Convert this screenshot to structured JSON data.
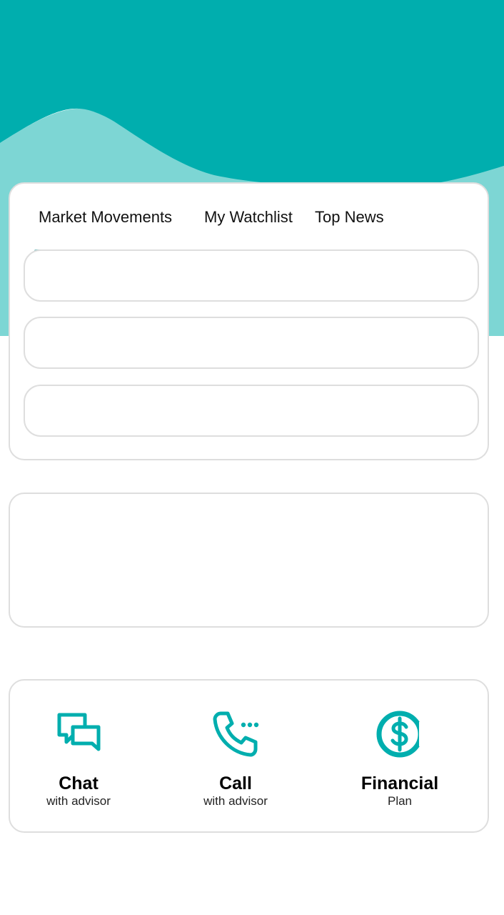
{
  "theme": {
    "primary_teal": "#00aeae",
    "light_teal": "#7dd6d4",
    "tab_underline": "#7dbfbf",
    "card_border": "#dedede"
  },
  "market_tabs": {
    "tabs": [
      {
        "label": "Market Movements",
        "selected": true
      },
      {
        "label": "My Watchlist",
        "selected": false
      },
      {
        "label": "Top News",
        "selected": false
      }
    ]
  },
  "services": [
    {
      "title": "Chat",
      "subtitle": "with advisor",
      "icon": "chat-bubbles-icon"
    },
    {
      "title": "Call",
      "subtitle": "with advisor",
      "icon": "phone-call-icon"
    },
    {
      "title": "Financial",
      "subtitle": "Plan",
      "icon": "dollar-circle-icon"
    }
  ]
}
